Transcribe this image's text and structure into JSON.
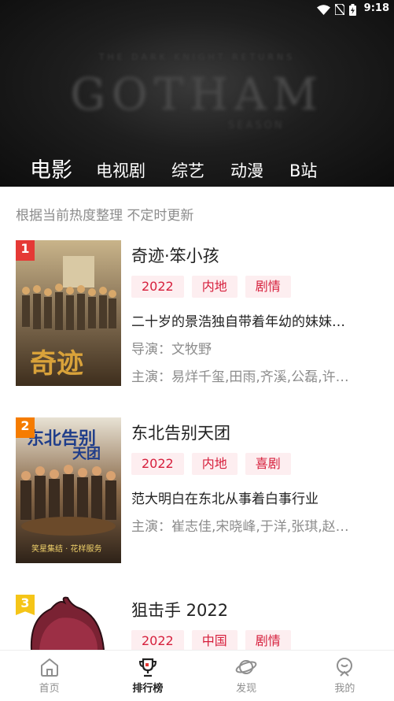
{
  "status_bar": {
    "time": "9:18"
  },
  "banner": {
    "title": "GOTHAM"
  },
  "category_tabs": [
    {
      "label": "电影",
      "active": true
    },
    {
      "label": "电视剧",
      "active": false
    },
    {
      "label": "综艺",
      "active": false
    },
    {
      "label": "动漫",
      "active": false
    },
    {
      "label": "B站",
      "active": false
    }
  ],
  "subtitle": "根据当前热度整理 不定时更新",
  "items": [
    {
      "rank": "1",
      "title": "奇迹·笨小孩",
      "tags": [
        "2022",
        "内地",
        "剧情"
      ],
      "description": "二十岁的景浩独自带着年幼的妹妹来到深圳生活",
      "director": "导演：文牧野",
      "cast": "主演：易烊千玺,田雨,齐溪,公磊,许君聪"
    },
    {
      "rank": "2",
      "title": "东北告别天团",
      "tags": [
        "2022",
        "内地",
        "喜剧"
      ],
      "description": "范大明白在东北从事着白事行业",
      "cast": "主演：崔志佳,宋晓峰,于洋,张琪,赵家琪"
    },
    {
      "rank": "3",
      "title": "狙击手 2022",
      "tags": [
        "2022",
        "中国",
        "剧情"
      ]
    }
  ],
  "bottom_nav": [
    {
      "label": "首页",
      "icon": "home-icon",
      "active": false
    },
    {
      "label": "排行榜",
      "icon": "trophy-icon",
      "active": true
    },
    {
      "label": "发现",
      "icon": "planet-icon",
      "active": false
    },
    {
      "label": "我的",
      "icon": "profile-icon",
      "active": false
    }
  ]
}
